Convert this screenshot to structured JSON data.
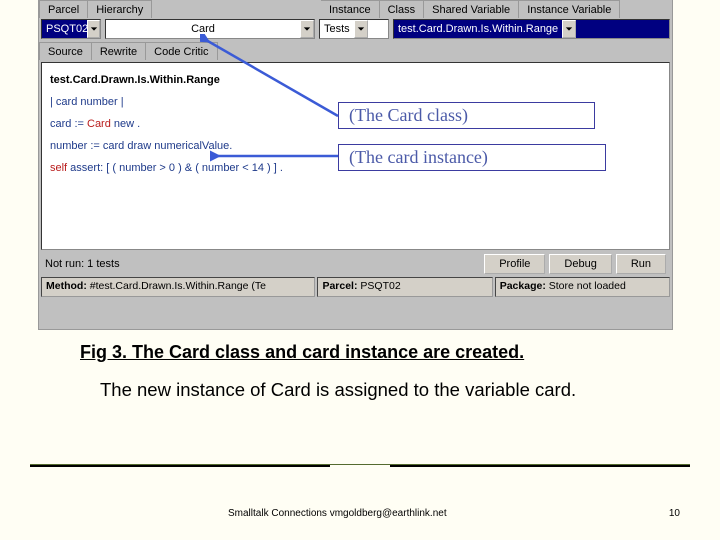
{
  "ide": {
    "topRow1": {
      "left": [
        "Parcel",
        "Hierarchy"
      ],
      "right": [
        "Instance",
        "Class",
        "Shared Variable",
        "Instance Variable"
      ]
    },
    "comboRow": {
      "parcel": "PSQT02",
      "classCombo": "Card",
      "tests": "Tests",
      "method": "test.Card.Drawn.Is.Within.Range"
    },
    "topRow2": [
      "Source",
      "Rewrite",
      "Code Critic"
    ],
    "code": {
      "l1": "test.Card.Drawn.Is.Within.Range",
      "l2": "| card number |",
      "l3a": "card := ",
      "l3b": "Card",
      "l3c": " new .",
      "l4a": "number := card draw numericalValue.",
      "l5a": "self",
      "l5b": " assert: ",
      "l5c": "[ ( number > 0 )   &   ( number  < 14 ) ] ."
    },
    "status": {
      "text": "Not run: 1 tests",
      "btnProfile": "Profile",
      "btnDebug": "Debug",
      "btnRun": "Run"
    },
    "methodRow": {
      "methodLabel": "Method:",
      "methodVal": "#test.Card.Drawn.Is.Within.Range (Te",
      "parcelLabel": "Parcel:",
      "parcelVal": "PSQT02",
      "packageLabel": "Package:",
      "packageVal": "Store not loaded"
    }
  },
  "callouts": {
    "cardClass": "(The Card class)",
    "cardInstance": "(The card instance)"
  },
  "figure": {
    "caption": "Fig 3. The Card class and card instance are created.",
    "body": "The new instance of Card is assigned to the variable card."
  },
  "footer": {
    "left": "Smalltalk Connections  vmgoldberg@earthlink.net",
    "page": "10"
  }
}
